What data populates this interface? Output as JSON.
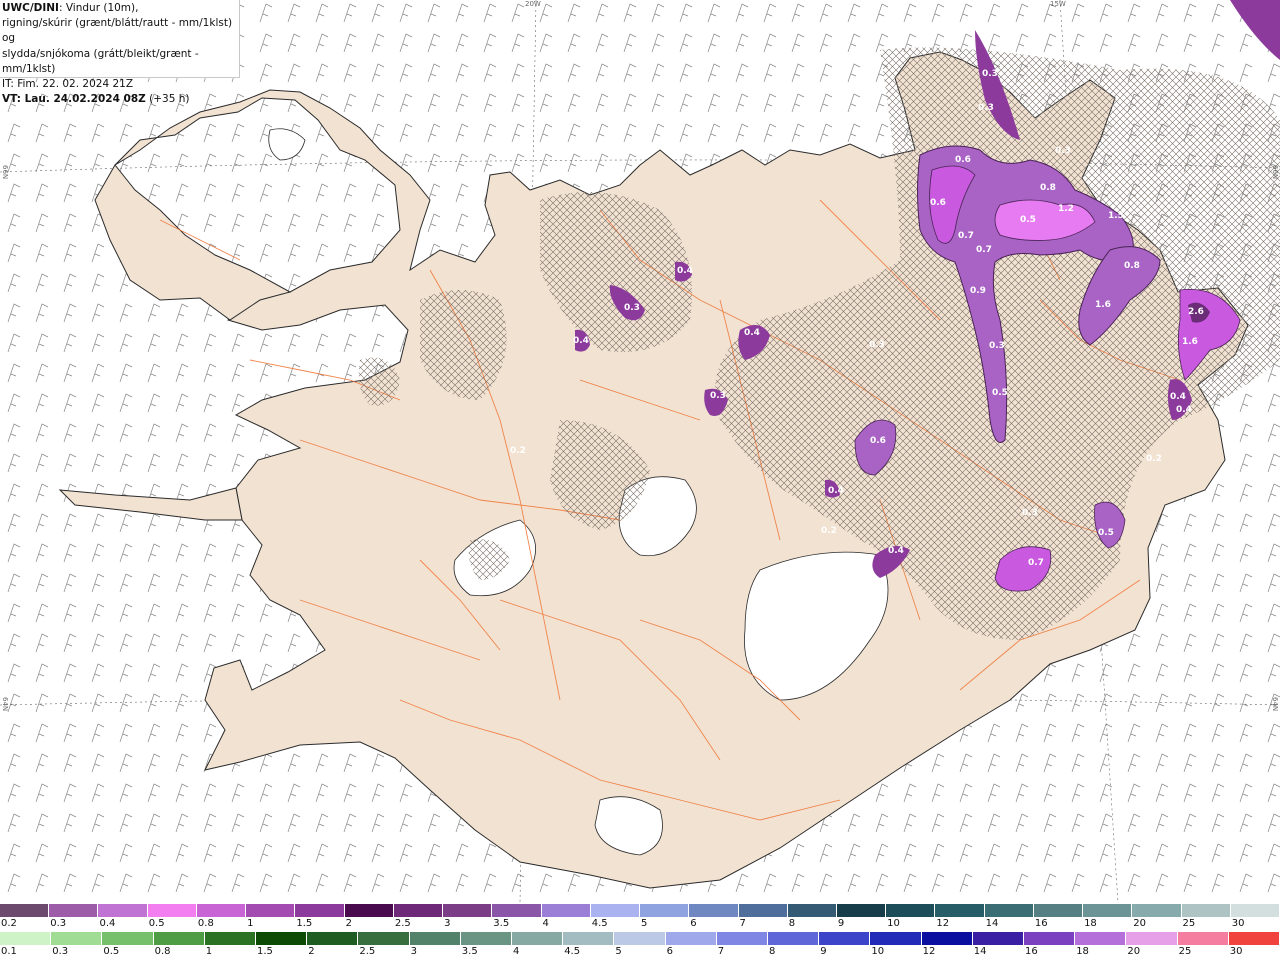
{
  "header": {
    "model": "UWC/DINI",
    "line1_rest": ": Vindur (10m),",
    "line2": "rigning/skúrir (grænt/blátt/rautt - mm/1klst) og",
    "line3": "slydda/snjókoma (grátt/bleikt/grænt - mm/1klst)",
    "line4": "IT: Fim. 22. 02. 2024 21Z",
    "line5_bold": "VT: Lau. 24.02.2024 08Z",
    "line5_rest": " (+35 h)"
  },
  "coords": {
    "lon_20w": "20W",
    "lon_15w": "15W",
    "lat_66n_left": "66N",
    "lat_66n_right": "66N",
    "lat_64n_left": "64N",
    "lat_64n_right": "64N"
  },
  "map_labels": [
    "0.3",
    "0.3",
    "0.6",
    "0.8",
    "0.5",
    "1.2",
    "1.5",
    "0.6",
    "0.7",
    "0.7",
    "0.8",
    "1.6",
    "0.9",
    "2.6",
    "1.6",
    "0.3",
    "0.5",
    "0.4",
    "0.4",
    "0.4",
    "0.3",
    "0.4",
    "0.4",
    "0.3",
    "0.6",
    "0.4",
    "0.2",
    "0.4",
    "0.5",
    "0.3",
    "0.7",
    "0.2",
    "0.2",
    "0.3",
    "0.3"
  ],
  "colors": {
    "land": "#f2e2d2",
    "ocean": "#ffffff",
    "roads": "#f07a3c",
    "snow_light": "#a863c4",
    "snow_mid": "#c95ae0",
    "snow_heavy": "#6b2c78",
    "snow_bright": "#e77cf2"
  },
  "scale_snow": {
    "labels": [
      "0.2",
      "0.3",
      "0.4",
      "0.5",
      "0.8",
      "1",
      "1.5",
      "2",
      "2.5",
      "3",
      "3.5",
      "4",
      "4.5",
      "5",
      "6",
      "7",
      "8",
      "9",
      "10",
      "12",
      "14",
      "16",
      "18",
      "20",
      "25",
      "30"
    ],
    "colors": [
      "#6c4a6e",
      "#9d5ca8",
      "#c073d3",
      "#f27ef0",
      "#c864d4",
      "#a44bb2",
      "#8c3a9c",
      "#4a0a4e",
      "#6e2a78",
      "#7b3e86",
      "#8a56a8",
      "#9b7fd6",
      "#aab3ef",
      "#8fa3e0",
      "#6f88c2",
      "#4f6e9c",
      "#355a74",
      "#173c4a",
      "#1d4d58",
      "#275d66",
      "#3b6e74",
      "#567f84",
      "#6c9396",
      "#87aaac",
      "#aec3c4",
      "#d3dede"
    ]
  },
  "scale_rain": {
    "labels": [
      "0.1",
      "0.3",
      "0.5",
      "0.8",
      "1",
      "1.5",
      "2",
      "2.5",
      "3",
      "3.5",
      "4",
      "4.5",
      "5",
      "6",
      "7",
      "8",
      "9",
      "10",
      "12",
      "14",
      "16",
      "18",
      "20",
      "25",
      "30"
    ],
    "colors": [
      "#cdf3c6",
      "#a1dc95",
      "#76c06c",
      "#4e9c44",
      "#2c7224",
      "#0c4a06",
      "#1f5c22",
      "#386d3e",
      "#52826a",
      "#6a9584",
      "#87a9a4",
      "#a2bcc2",
      "#bcc9e6",
      "#9ea8ea",
      "#7f86e3",
      "#5e66d8",
      "#3c45c9",
      "#222bb8",
      "#0b0fa0",
      "#3a1ea3",
      "#7a40c0",
      "#b46fdb",
      "#e6a0e7",
      "#f57d9f",
      "#f0433e"
    ]
  }
}
